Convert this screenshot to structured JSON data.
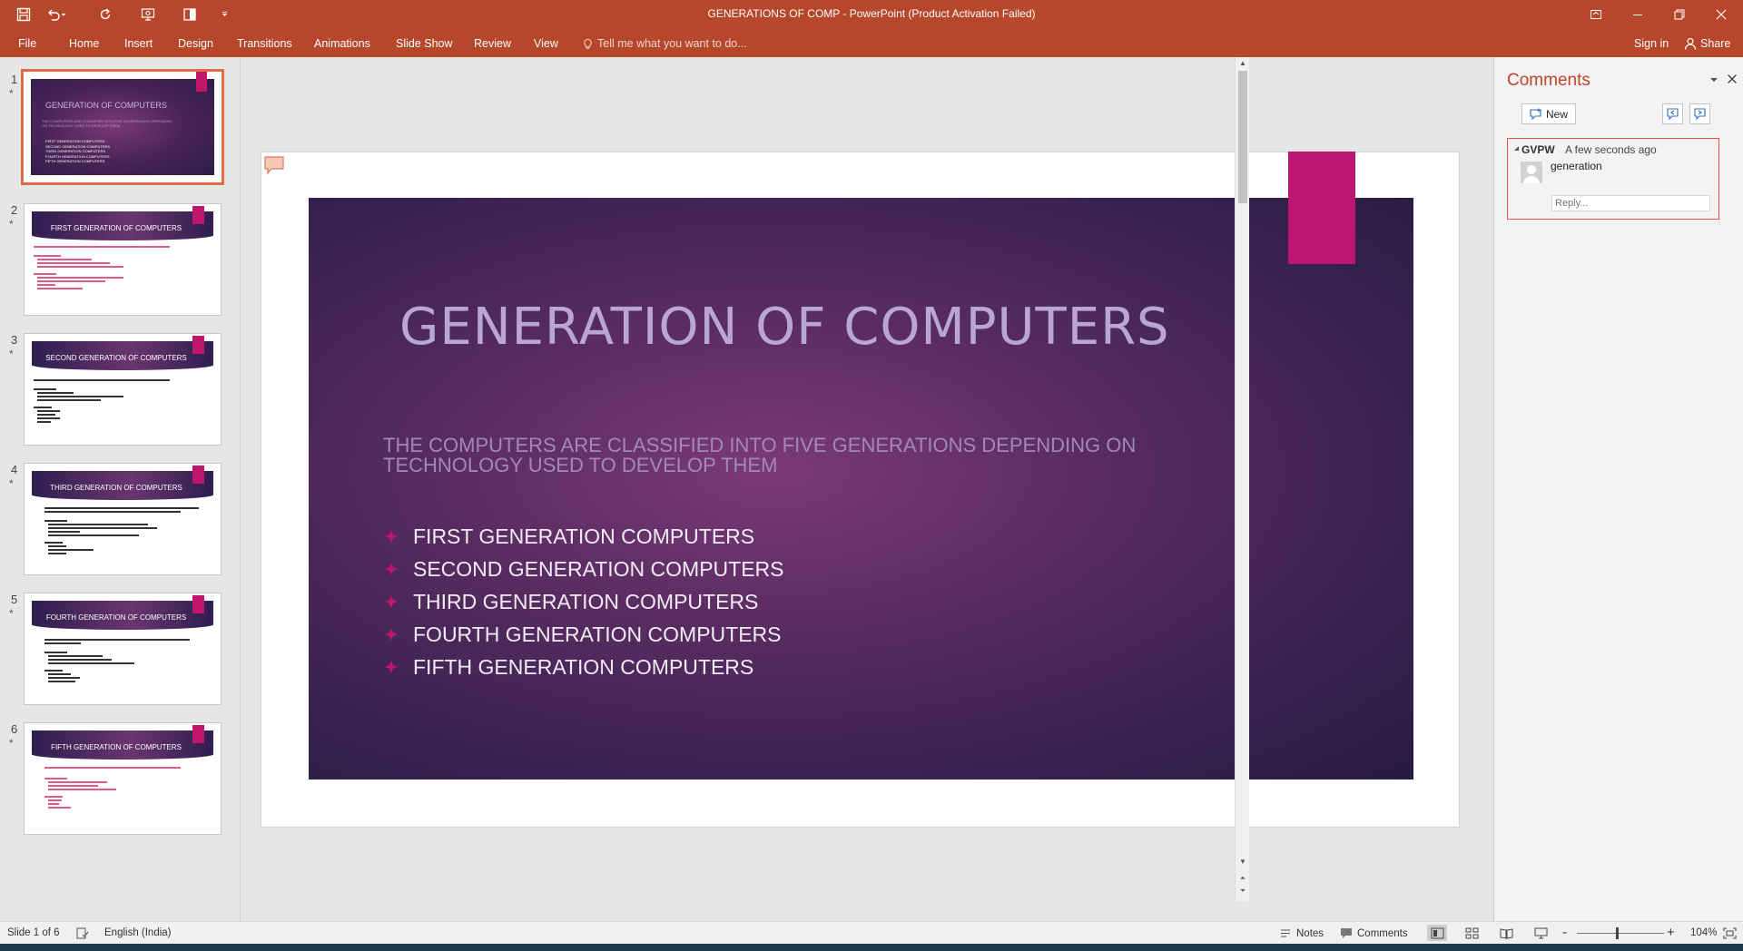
{
  "window": {
    "title": "GENERATIONS OF COMP - PowerPoint (Product Activation Failed)"
  },
  "ribbon": {
    "tabs": [
      "File",
      "Home",
      "Insert",
      "Design",
      "Transitions",
      "Animations",
      "Slide Show",
      "Review",
      "View"
    ],
    "tell_me": "Tell me what you want to do...",
    "sign_in": "Sign in",
    "share": "Share"
  },
  "thumbnails": {
    "items": [
      {
        "number": "1",
        "title": "GENERATION OF COMPUTERS",
        "selected": true,
        "subtitle": "THE COMPUTERS ARE CLASSIFIED INTO FIVE GENERATIONS DEPENDING ON TECHNOLOGY USED TO DEVELOP THEM",
        "list": [
          "FIRST GENERATION COMPUTERS",
          "SECOND GENERATION COMPUTERS",
          "THIRD GENERATION COMPUTERS",
          "FOURTH GENERATION COMPUTERS",
          "FIFTH GENERATION COMPUTERS"
        ]
      },
      {
        "number": "2",
        "title": "FIRST GENERATION OF COMPUTERS",
        "selected": false
      },
      {
        "number": "3",
        "title": "SECOND GENERATION OF COMPUTERS",
        "selected": false
      },
      {
        "number": "4",
        "title": "THIRD GENERATION OF COMPUTERS",
        "selected": false
      },
      {
        "number": "5",
        "title": "FOURTH GENERATION OF COMPUTERS",
        "selected": false
      },
      {
        "number": "6",
        "title": "FIFTH GENERATION OF COMPUTERS",
        "selected": false
      }
    ],
    "animation_marker": "*"
  },
  "slide": {
    "title": "GENERATION OF COMPUTERS",
    "subtitle": "THE COMPUTERS ARE CLASSIFIED INTO FIVE GENERATIONS DEPENDING ON TECHNOLOGY USED TO DEVELOP THEM",
    "bullets": [
      "FIRST GENERATION COMPUTERS",
      "SECOND GENERATION COMPUTERS",
      "THIRD GENERATION COMPUTERS",
      "FOURTH GENERATION COMPUTERS",
      "FIFTH GENERATION COMPUTERS"
    ],
    "colors": {
      "accent_flag": "#ba1672",
      "bullet": "#c0166c"
    }
  },
  "comments_pane": {
    "title": "Comments",
    "new_label": "New",
    "comment": {
      "author": "GVPW",
      "time": "A few seconds ago",
      "text": "generation",
      "reply_placeholder": "Reply..."
    }
  },
  "status_bar": {
    "slide_info": "Slide 1 of 6",
    "language": "English (India)",
    "notes": "Notes",
    "comments": "Comments",
    "zoom_minus": "-",
    "zoom_plus": "+",
    "zoom": "104%"
  },
  "theme": {
    "ribbon": "#b7472a",
    "accent": "#c0432a"
  }
}
